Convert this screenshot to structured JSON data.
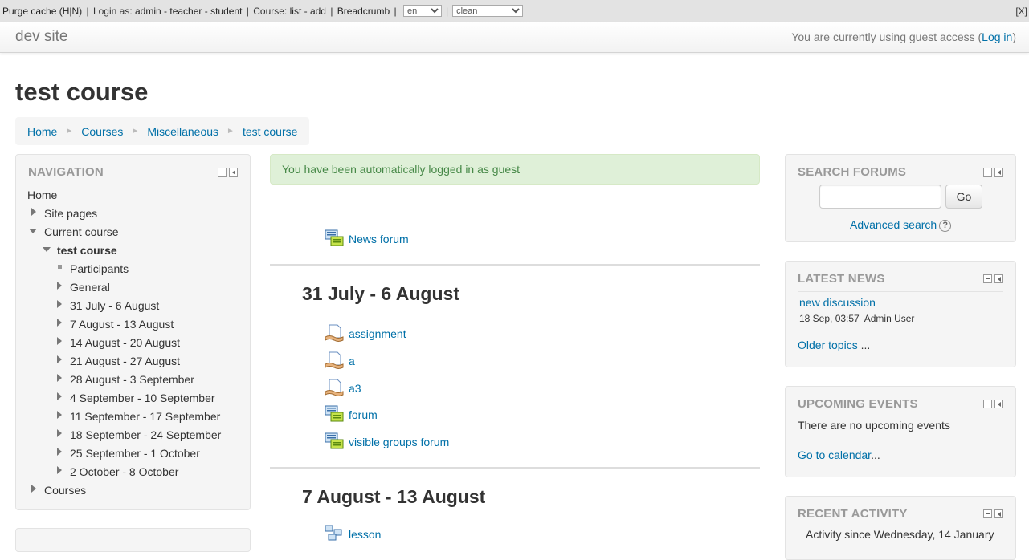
{
  "devbar": {
    "purge": "Purge cache (H|N)",
    "login_as": "Login as:",
    "admin": "admin",
    "teacher": "teacher",
    "student": "student",
    "course": "Course:",
    "list": "list",
    "add": "add",
    "breadcrumb": "Breadcrumb",
    "lang_value": "en",
    "theme_value": "clean",
    "close": "[X]"
  },
  "header": {
    "brand": "dev site",
    "login_prefix": "You are currently using guest access (",
    "login_link": "Log in",
    "login_suffix": ")"
  },
  "page_title": "test course",
  "breadcrumb": [
    "Home",
    "Courses",
    "Miscellaneous",
    "test course"
  ],
  "navigation": {
    "title": "NAVIGATION",
    "home": "Home",
    "site_pages": "Site pages",
    "current_course": "Current course",
    "course": "test course",
    "participants": "Participants",
    "general": "General",
    "weeks": [
      "31 July - 6 August",
      "7 August - 13 August",
      "14 August - 20 August",
      "21 August - 27 August",
      "28 August - 3 September",
      "4 September - 10 September",
      "11 September - 17 September",
      "18 September - 24 September",
      "25 September - 1 October",
      "2 October - 8 October"
    ],
    "courses": "Courses"
  },
  "alert": "You have been automatically logged in as guest",
  "main": {
    "news_forum": "News forum",
    "section1_title": "31 July - 6 August",
    "section1_items": [
      "assignment",
      "a",
      "a3",
      "forum",
      "visible groups forum"
    ],
    "section2_title": "7 August - 13 August",
    "section2_items": [
      "lesson"
    ]
  },
  "search_forums": {
    "title": "SEARCH FORUMS",
    "go": "Go",
    "advanced": "Advanced search",
    "help": "?"
  },
  "latest_news": {
    "title": "LATEST NEWS",
    "item": "new discussion",
    "meta": "18 Sep, 03:57  Admin User",
    "older": "Older topics",
    "older_suffix": " ..."
  },
  "upcoming": {
    "title": "UPCOMING EVENTS",
    "text": "There are no upcoming events",
    "calendar": "Go to calendar",
    "calendar_suffix": "..."
  },
  "recent": {
    "title": "RECENT ACTIVITY",
    "text": "Activity since Wednesday, 14 January"
  },
  "colors": {
    "link": "#0070a8",
    "alert_bg": "#dff0d8",
    "alert_text": "#468847",
    "block_bg": "#f5f5f5"
  }
}
